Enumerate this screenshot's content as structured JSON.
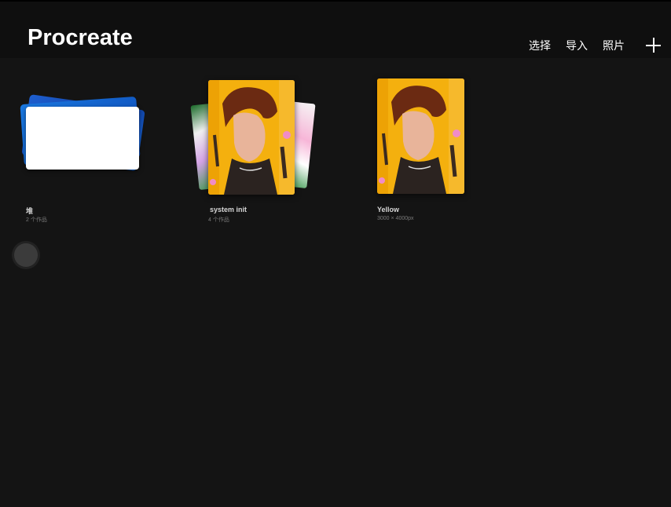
{
  "header": {
    "app_title": "Procreate",
    "select_label": "选择",
    "import_label": "导入",
    "photo_label": "照片",
    "add_icon": "plus-icon"
  },
  "gallery": [
    {
      "title": "堆",
      "subtitle": "2 个作品"
    },
    {
      "title": "system init",
      "subtitle": "4 个作品"
    },
    {
      "title": "Yellow",
      "subtitle": "3000 × 4000px"
    }
  ],
  "colors": {
    "background": "#141414",
    "header": "#0f0f0f",
    "art_yellow": "#f4b00e",
    "stack_blue": "#1e5fd0"
  }
}
